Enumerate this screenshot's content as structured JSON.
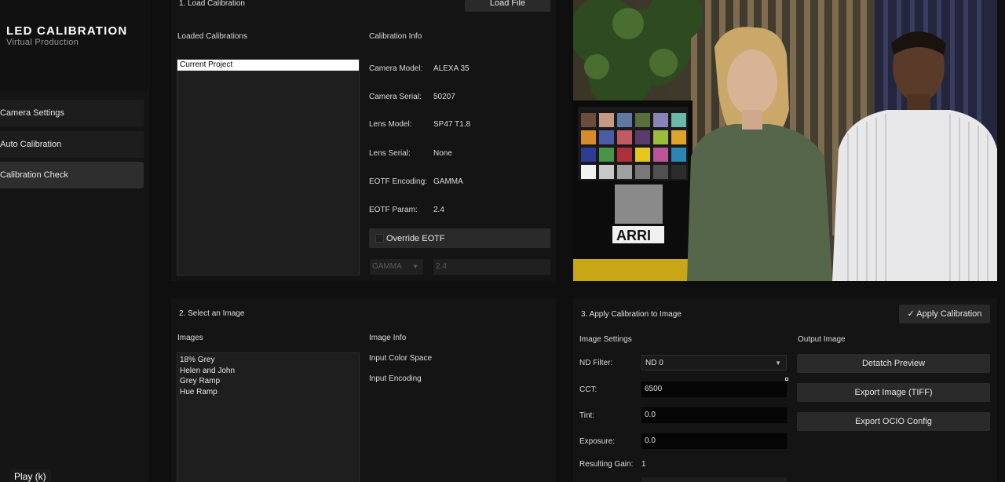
{
  "sidebar": {
    "title": "LED CALIBRATION",
    "subtitle": "Virtual Production",
    "items": [
      {
        "label": "Camera Settings"
      },
      {
        "label": "Auto Calibration"
      },
      {
        "label": "Calibration Check"
      }
    ]
  },
  "load_section": {
    "title": "1. Load Calibration",
    "load_button": "Load File",
    "loaded_label": "Loaded Calibrations",
    "loaded_items": [
      "Current Project"
    ],
    "info_label": "Calibration Info",
    "info": [
      {
        "key": "Camera Model:",
        "value": "ALEXA 35"
      },
      {
        "key": "Camera Serial:",
        "value": "50207"
      },
      {
        "key": "Lens Model:",
        "value": "SP47 T1.8"
      },
      {
        "key": "Lens Serial:",
        "value": "None"
      },
      {
        "key": "EOTF Encoding:",
        "value": "GAMMA"
      },
      {
        "key": "EOTF Param:",
        "value": "2.4"
      }
    ],
    "override_label": "Override EOTF",
    "override_checked": false,
    "eotf_select": "GAMMA",
    "eotf_value": "2.4"
  },
  "image_section": {
    "title": "2. Select an Image",
    "images_label": "Images",
    "images": [
      "18% Grey",
      "Helen and John",
      "Grey Ramp",
      "Hue Ramp"
    ],
    "info_label": "Image Info",
    "input_color_space": "Input Color Space",
    "input_encoding": "Input Encoding"
  },
  "apply_section": {
    "title": "3. Apply Calibration to Image",
    "apply_button": "✓  Apply Calibration",
    "settings_label": "Image Settings",
    "nd_label": "ND Filter:",
    "nd_value": "ND 0",
    "cct_label": "CCT:",
    "cct_value": "6500",
    "tint_label": "Tint:",
    "tint_value": "0.0",
    "exposure_label": "Exposure:",
    "exposure_value": "0.0",
    "gain_label": "Resulting Gain:",
    "gain_value": "1",
    "output_label": "Output Image",
    "detatch_button": "Detatch Preview",
    "export_tiff_button": "Export Image (TIFF)",
    "export_ocio_button": "Export OCIO Config"
  },
  "preview": {
    "chart_logo": "ARRI"
  },
  "player": {
    "tooltip": "Play (k)"
  },
  "colors": {
    "background": "#0f0f0f",
    "panel": "#141414",
    "button": "#2a2a2a",
    "selected": "#ffffff"
  }
}
